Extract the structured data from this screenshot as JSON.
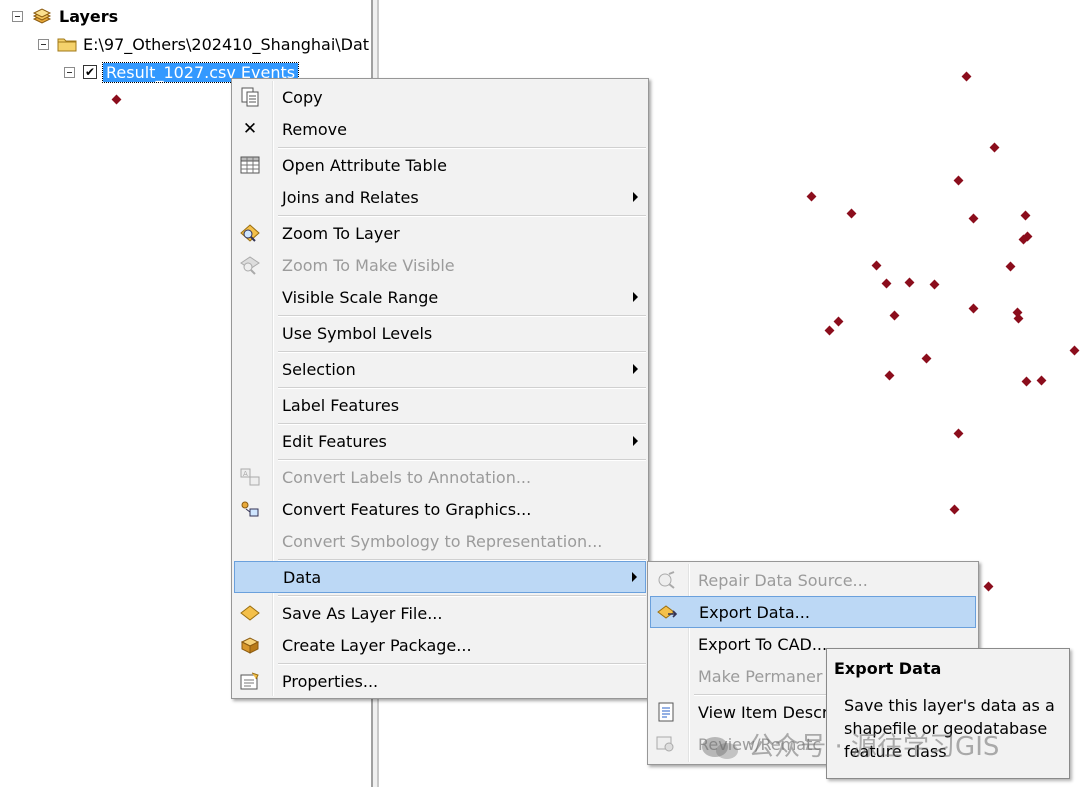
{
  "toc": {
    "root_label": "Layers",
    "folder_label": "E:\\97_Others\\202410_Shanghai\\Dat",
    "layer_label": "Result_1027.csv Events",
    "layer_checked": true
  },
  "context_menu": {
    "items": [
      {
        "label": "Copy",
        "icon": "copy-icon",
        "enabled": true
      },
      {
        "label": "Remove",
        "icon": "remove-icon",
        "enabled": true
      },
      {
        "label": "Open Attribute Table",
        "icon": "table-icon",
        "enabled": true
      },
      {
        "label": "Joins and Relates",
        "enabled": true,
        "submenu": true
      },
      {
        "label": "Zoom To Layer",
        "icon": "zoom-to-layer-icon",
        "enabled": true
      },
      {
        "label": "Zoom To Make Visible",
        "icon": "zoom-visible-icon",
        "enabled": false
      },
      {
        "label": "Visible Scale Range",
        "enabled": true,
        "submenu": true
      },
      {
        "label": "Use Symbol Levels",
        "enabled": true
      },
      {
        "label": "Selection",
        "enabled": true,
        "submenu": true
      },
      {
        "label": "Label Features",
        "enabled": true
      },
      {
        "label": "Edit Features",
        "enabled": true,
        "submenu": true
      },
      {
        "label": "Convert Labels to Annotation...",
        "icon": "convert-labels-icon",
        "enabled": false
      },
      {
        "label": "Convert Features to Graphics...",
        "icon": "convert-features-icon",
        "enabled": true
      },
      {
        "label": "Convert Symbology to Representation...",
        "enabled": false
      },
      {
        "label": "Data",
        "enabled": true,
        "submenu": true,
        "highlighted": true
      },
      {
        "label": "Save As Layer File...",
        "icon": "layer-file-icon",
        "enabled": true
      },
      {
        "label": "Create Layer Package...",
        "icon": "layer-package-icon",
        "enabled": true
      },
      {
        "label": "Properties...",
        "icon": "properties-icon",
        "enabled": true
      }
    ]
  },
  "data_submenu": {
    "items": [
      {
        "label": "Repair Data Source...",
        "icon": "repair-icon",
        "enabled": false
      },
      {
        "label": "Export Data...",
        "icon": "export-data-icon",
        "enabled": true,
        "highlighted": true
      },
      {
        "label": "Export To CAD...",
        "enabled": true
      },
      {
        "label": "Make Permaner",
        "enabled": false
      },
      {
        "label": "View Item Descr",
        "icon": "item-description-icon",
        "enabled": true
      },
      {
        "label": "Review/Rematc",
        "icon": "review-icon",
        "enabled": false
      }
    ]
  },
  "tooltip": {
    "title": "Export Data",
    "body": "Save this layer's data as a shapefile or geodatabase feature class"
  },
  "watermark": "公众号 · 源往学习GIS",
  "colors": {
    "point_symbol": "#8b0d1c",
    "selection_blue": "#3399ff",
    "menu_highlight": "#bcd8f5"
  }
}
